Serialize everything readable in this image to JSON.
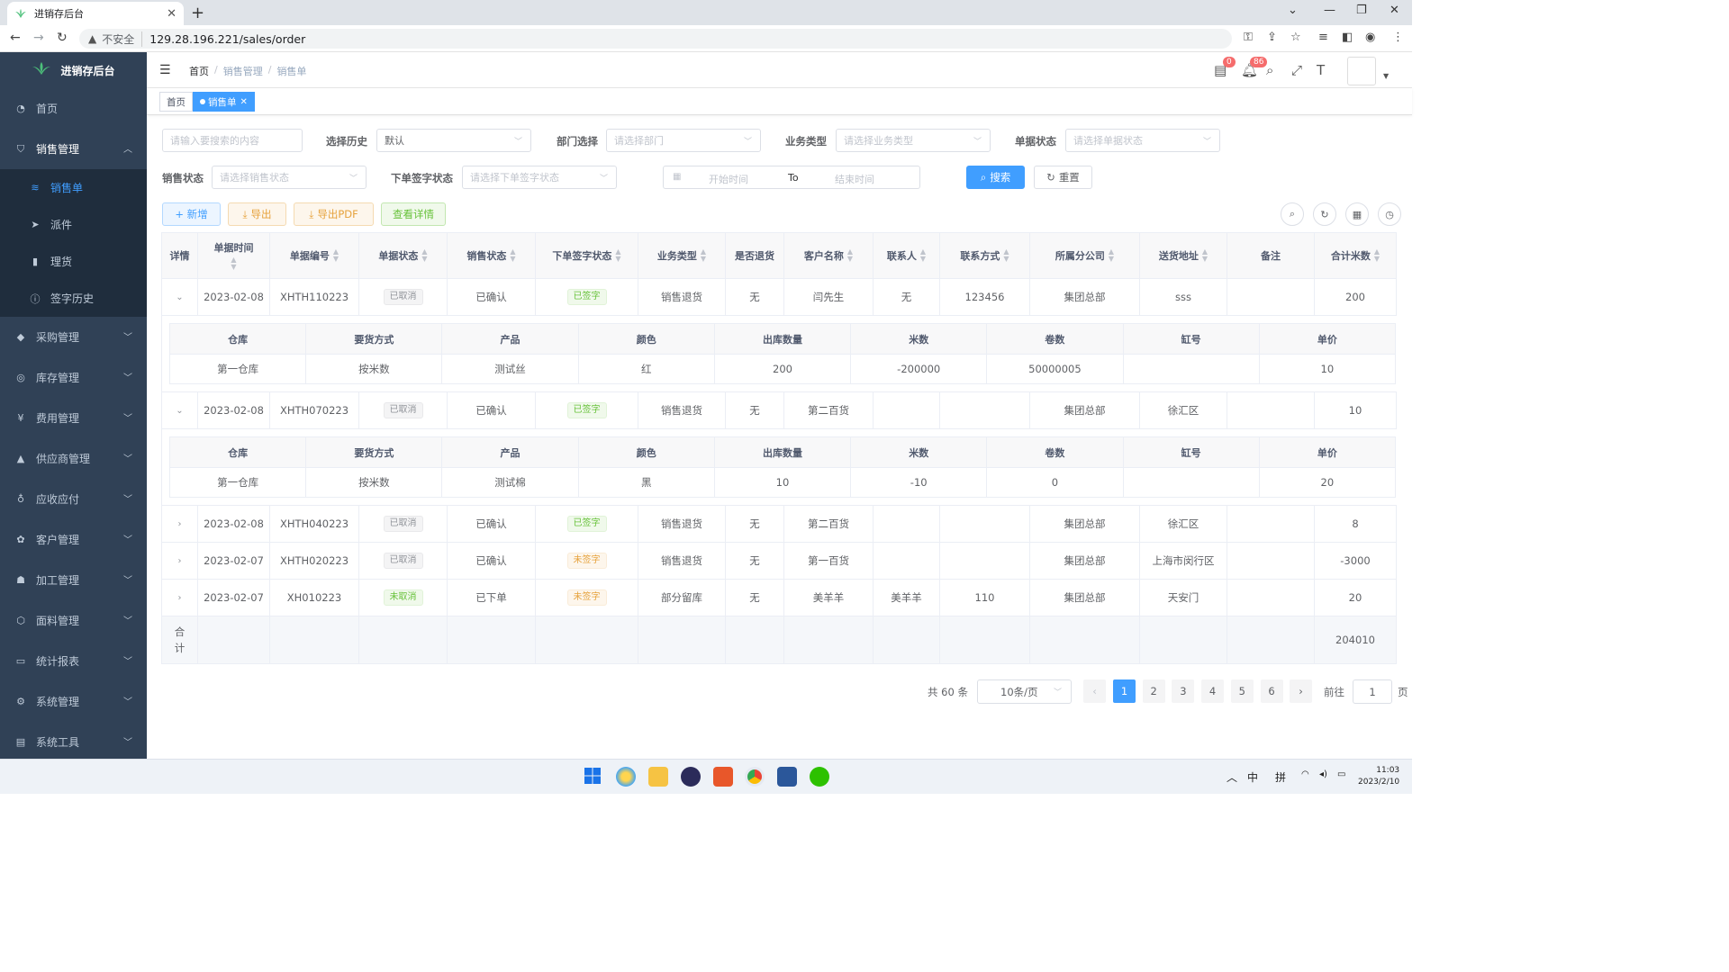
{
  "browser": {
    "tab_title": "进销存后台",
    "new_tab": "+",
    "security": "不安全",
    "url": "129.28.196.221/sales/order"
  },
  "sidebar": {
    "logo_text": "进销存后台",
    "items": [
      {
        "label": "首页",
        "icon": "dashboard-icon"
      },
      {
        "label": "销售管理",
        "icon": "sales-icon"
      },
      {
        "label": "采购管理",
        "icon": "purchase-icon"
      },
      {
        "label": "库存管理",
        "icon": "inventory-icon"
      },
      {
        "label": "费用管理",
        "icon": "yen-icon"
      },
      {
        "label": "供应商管理",
        "icon": "supplier-icon"
      },
      {
        "label": "应收应付",
        "icon": "finance-icon"
      },
      {
        "label": "客户管理",
        "icon": "customer-icon"
      },
      {
        "label": "加工管理",
        "icon": "process-icon"
      },
      {
        "label": "面料管理",
        "icon": "fabric-icon"
      },
      {
        "label": "统计报表",
        "icon": "report-icon"
      },
      {
        "label": "系统管理",
        "icon": "settings-icon"
      },
      {
        "label": "系统工具",
        "icon": "tools-icon"
      }
    ],
    "sales_sub": [
      {
        "label": "销售单",
        "icon": "layers-icon"
      },
      {
        "label": "派件",
        "icon": "send-icon"
      },
      {
        "label": "理货",
        "icon": "bar-chart-icon"
      },
      {
        "label": "签字历史",
        "icon": "info-icon"
      }
    ]
  },
  "header": {
    "breadcrumb": [
      "首页",
      "销售管理",
      "销售单"
    ],
    "breadcrumb_sep": "/",
    "msg_badge": "0",
    "bell_badge": "86"
  },
  "tags": {
    "home": "首页",
    "current": "销售单"
  },
  "filters": {
    "search_placeholder": "请输入要搜索的内容",
    "history_label": "选择历史",
    "history_value": "默认",
    "dept_label": "部门选择",
    "dept_placeholder": "请选择部门",
    "biz_label": "业务类型",
    "biz_placeholder": "请选择业务类型",
    "doc_status_label": "单据状态",
    "doc_status_placeholder": "请选择单据状态",
    "sales_status_label": "销售状态",
    "sales_status_placeholder": "请选择销售状态",
    "sign_label": "下单签字状态",
    "sign_placeholder": "请选择下单签字状态",
    "start_placeholder": "开始时间",
    "range_sep": "To",
    "end_placeholder": "结束时间",
    "search_btn": "搜索",
    "reset_btn": "重置"
  },
  "toolbar": {
    "add": "+ 新增",
    "export": "导出",
    "export_pdf": "导出PDF",
    "details": "查看详情"
  },
  "table": {
    "headers": [
      "详情",
      "单据时间",
      "单据编号",
      "单据状态",
      "销售状态",
      "下单签字状态",
      "业务类型",
      "是否退货",
      "客户名称",
      "联系人",
      "联系方式",
      "所属分公司",
      "送货地址",
      "备注",
      "合计米数"
    ],
    "sub_headers": [
      "仓库",
      "要货方式",
      "产品",
      "颜色",
      "出库数量",
      "米数",
      "卷数",
      "缸号",
      "单价"
    ],
    "rows": [
      {
        "date": "2023-02-08",
        "no": "XHTH110223",
        "doc_status": "已取消",
        "sales_status": "已确认",
        "sign": "已签字",
        "biz": "销售退货",
        "ret": "无",
        "customer": "闫先生",
        "contact": "无",
        "phone": "123456",
        "branch": "集团总部",
        "addr": "sss",
        "remark": "",
        "meters": "200",
        "expanded": true,
        "detail": [
          "第一仓库",
          "按米数",
          "测试丝",
          "红",
          "200",
          "-200000",
          "50000005",
          "",
          "10"
        ]
      },
      {
        "date": "2023-02-08",
        "no": "XHTH070223",
        "doc_status": "已取消",
        "sales_status": "已确认",
        "sign": "已签字",
        "biz": "销售退货",
        "ret": "无",
        "customer": "第二百货",
        "contact": "",
        "phone": "",
        "branch": "集团总部",
        "addr": "徐汇区",
        "remark": "",
        "meters": "10",
        "expanded": true,
        "detail": [
          "第一仓库",
          "按米数",
          "测试棉",
          "黑",
          "10",
          "-10",
          "0",
          "",
          "20"
        ]
      },
      {
        "date": "2023-02-08",
        "no": "XHTH040223",
        "doc_status": "已取消",
        "sales_status": "已确认",
        "sign": "已签字",
        "biz": "销售退货",
        "ret": "无",
        "customer": "第二百货",
        "contact": "",
        "phone": "",
        "branch": "集团总部",
        "addr": "徐汇区",
        "remark": "",
        "meters": "8",
        "expanded": false
      },
      {
        "date": "2023-02-07",
        "no": "XHTH020223",
        "doc_status": "已取消",
        "sales_status": "已确认",
        "sign": "未签字",
        "biz": "销售退货",
        "ret": "无",
        "customer": "第一百货",
        "contact": "",
        "phone": "",
        "branch": "集团总部",
        "addr": "上海市闵行区",
        "remark": "",
        "meters": "-3000",
        "expanded": false
      },
      {
        "date": "2023-02-07",
        "no": "XH010223",
        "doc_status": "未取消",
        "sales_status": "已下单",
        "sign": "未签字",
        "biz": "部分留库",
        "ret": "无",
        "customer": "美羊羊",
        "contact": "美羊羊",
        "phone": "110",
        "branch": "集团总部",
        "addr": "天安门",
        "remark": "",
        "meters": "20",
        "expanded": false
      }
    ],
    "summary_label": "合计",
    "summary_total": "204010"
  },
  "pagination": {
    "total": "共 60 条",
    "page_size": "10条/页",
    "pages": [
      "1",
      "2",
      "3",
      "4",
      "5",
      "6"
    ],
    "current": "1",
    "goto_label": "前往",
    "goto_value": "1",
    "goto_suffix": "页"
  },
  "taskbar": {
    "ime1": "中",
    "ime2": "拼",
    "time": "11:03",
    "date": "2023/2/10"
  },
  "colors": {
    "primary": "#409eff",
    "sidebar": "#304156",
    "submenu": "#1f2d3d",
    "success": "#67c23a",
    "warning": "#e6a23c"
  }
}
